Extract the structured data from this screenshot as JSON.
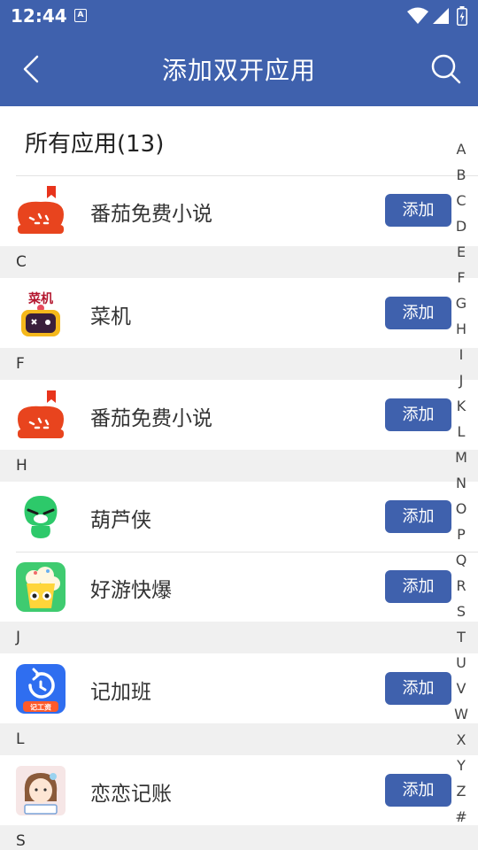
{
  "status": {
    "time": "12:44",
    "notif_letter": "A"
  },
  "appbar": {
    "title": "添加双开应用"
  },
  "section": {
    "title": "所有应用(13)"
  },
  "headers": [
    "C",
    "F",
    "H",
    "J",
    "L",
    "S"
  ],
  "apps": [
    {
      "name": "番茄免费小说",
      "add_label": "添加",
      "icon": "tomato-novel-icon"
    },
    {
      "name": "菜机",
      "add_label": "添加",
      "icon": "caiji-icon"
    },
    {
      "name": "番茄免费小说",
      "add_label": "添加",
      "icon": "tomato-novel-icon"
    },
    {
      "name": "葫芦侠",
      "add_label": "添加",
      "icon": "huluxia-icon"
    },
    {
      "name": "好游快爆",
      "add_label": "添加",
      "icon": "haoyou-icon"
    },
    {
      "name": "记加班",
      "add_label": "添加",
      "icon": "jijiaban-icon"
    },
    {
      "name": "恋恋记账",
      "add_label": "添加",
      "icon": "lianlian-icon"
    }
  ],
  "icon_texts": {
    "caiji": "菜机",
    "jijiaban": "记工资"
  },
  "index": [
    "A",
    "B",
    "C",
    "D",
    "E",
    "F",
    "G",
    "H",
    "I",
    "J",
    "K",
    "L",
    "M",
    "N",
    "O",
    "P",
    "Q",
    "R",
    "S",
    "T",
    "U",
    "V",
    "W",
    "X",
    "Y",
    "Z",
    "#"
  ],
  "colors": {
    "primary": "#3f61ad",
    "header_bg": "#f0f0f0"
  }
}
